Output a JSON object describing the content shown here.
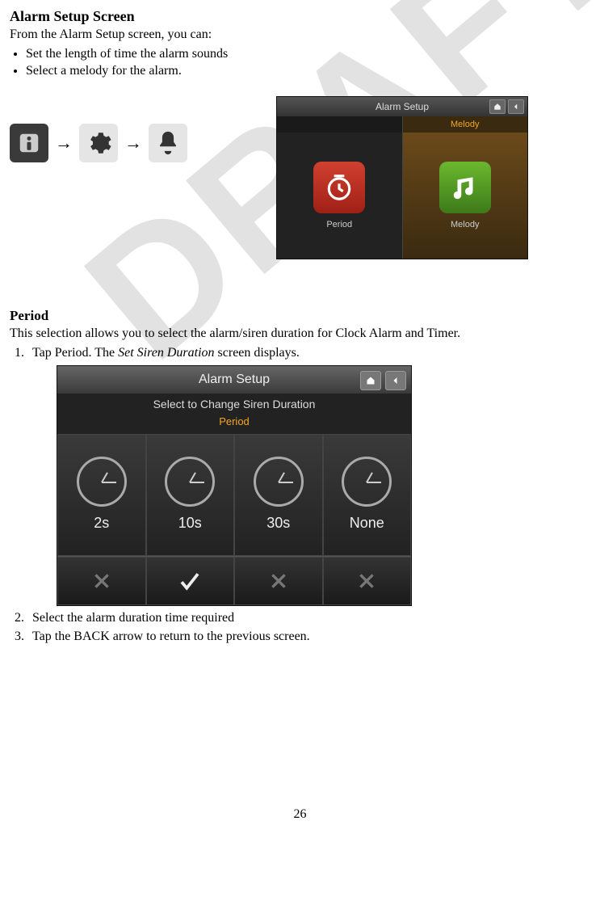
{
  "title": "Alarm Setup Screen",
  "intro": "From the Alarm Setup screen, you can:",
  "bullets": [
    "Set the length of time the alarm sounds",
    "Select a melody for the alarm."
  ],
  "nav_arrow": "→",
  "screenshot1": {
    "title": "Alarm Setup",
    "tab_selected": "Melody",
    "period_label": "Period",
    "melody_label": "Melody"
  },
  "section2_heading": "Period",
  "section2_intro": "This selection allows you to select the alarm/siren duration for Clock Alarm and Timer.",
  "step1_prefix": "Tap Period. The ",
  "step1_italic": "Set Siren Duration",
  "step1_suffix": " screen displays.",
  "screenshot2": {
    "title": "Alarm Setup",
    "subtitle": "Select to Change Siren Duration",
    "tab": "Period",
    "options": [
      "2s",
      "10s",
      "30s",
      "None"
    ],
    "selected_index": 1
  },
  "step2": "Select the alarm duration time required",
  "step3": "Tap the BACK arrow to return to the previous screen.",
  "watermark": "DRAFT",
  "page_number": "26"
}
